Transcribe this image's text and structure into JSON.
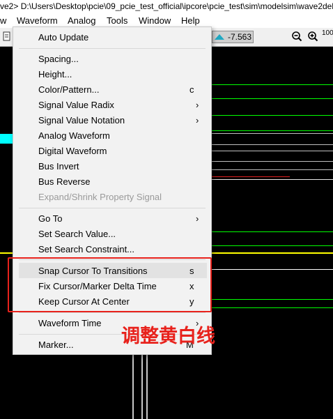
{
  "titlebar": {
    "text": "ve2> D:\\Users\\Desktop\\pcie\\09_pcie_test_official\\ipcore\\pcie_test\\sim\\modelsim\\wave2deb"
  },
  "menubar": [
    {
      "label": "w"
    },
    {
      "label": "Waveform"
    },
    {
      "label": "Analog"
    },
    {
      "label": "Tools"
    },
    {
      "label": "Window"
    },
    {
      "label": "Help"
    }
  ],
  "toolbar": {
    "cursor_value": "-7.563",
    "zoom_text": "100"
  },
  "menu": {
    "items": [
      {
        "label": "Auto Update",
        "shortcut": "",
        "submenu": false,
        "disabled": false
      },
      {
        "label": "Spacing...",
        "shortcut": "",
        "submenu": false,
        "disabled": false
      },
      {
        "label": "Height...",
        "shortcut": "",
        "submenu": false,
        "disabled": false
      },
      {
        "label": "Color/Pattern...",
        "shortcut": "c",
        "submenu": false,
        "disabled": false
      },
      {
        "label": "Signal Value Radix",
        "shortcut": "",
        "submenu": true,
        "disabled": false
      },
      {
        "label": "Signal Value Notation",
        "shortcut": "",
        "submenu": true,
        "disabled": false
      },
      {
        "label": "Analog Waveform",
        "shortcut": "",
        "submenu": false,
        "disabled": false
      },
      {
        "label": "Digital Waveform",
        "shortcut": "",
        "submenu": false,
        "disabled": false
      },
      {
        "label": "Bus Invert",
        "shortcut": "",
        "submenu": false,
        "disabled": false
      },
      {
        "label": "Bus Reverse",
        "shortcut": "",
        "submenu": false,
        "disabled": false
      },
      {
        "label": "Expand/Shrink Property Signal",
        "shortcut": "",
        "submenu": false,
        "disabled": true
      },
      {
        "label": "Go To",
        "shortcut": "",
        "submenu": true,
        "disabled": false
      },
      {
        "label": "Set Search Value...",
        "shortcut": "",
        "submenu": false,
        "disabled": false
      },
      {
        "label": "Set Search Constraint...",
        "shortcut": "",
        "submenu": false,
        "disabled": false
      },
      {
        "label": "Snap Cursor To Transitions",
        "shortcut": "s",
        "submenu": false,
        "disabled": false
      },
      {
        "label": "Fix Cursor/Marker Delta Time",
        "shortcut": "x",
        "submenu": false,
        "disabled": false
      },
      {
        "label": "Keep Cursor At Center",
        "shortcut": "y",
        "submenu": false,
        "disabled": false
      },
      {
        "label": "Waveform Time",
        "shortcut": "",
        "submenu": true,
        "disabled": false
      },
      {
        "label": "Marker...",
        "shortcut": "M",
        "submenu": false,
        "disabled": false
      }
    ],
    "arrow_glyph": "›"
  },
  "annotation": {
    "text": "调整黄白线",
    "color": "#e8221c"
  },
  "colors": {
    "accent": "#1fa8c2",
    "annotation_red": "#e8221c",
    "wave_green": "#00ff00",
    "wave_yellow": "#ffff00",
    "wave_cyan": "#00ffff"
  }
}
